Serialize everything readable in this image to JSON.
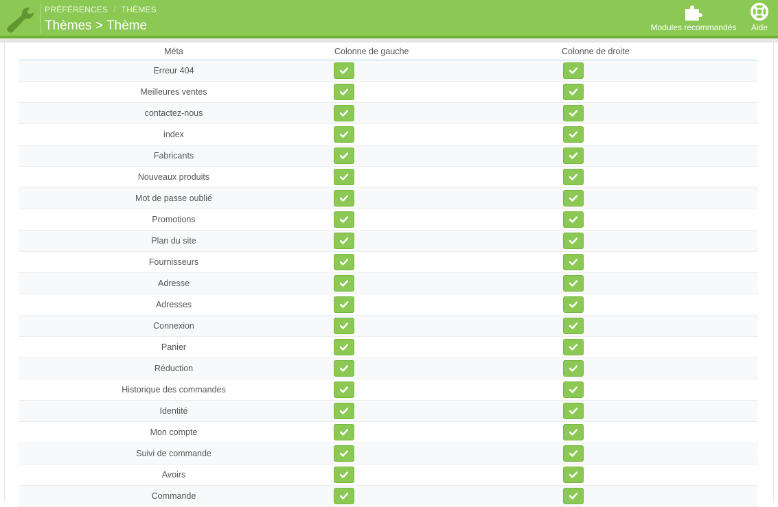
{
  "header": {
    "breadcrumb": [
      "PRÉFÉRENCES",
      "THÈMES"
    ],
    "breadcrumb_separator": "/",
    "title": "Thèmes > Thème",
    "toolbar": [
      {
        "label": "Modules recommandés",
        "icon": "puzzle-icon"
      },
      {
        "label": "Aide",
        "icon": "lifebuoy-icon"
      }
    ],
    "brand_icon": "wrench-icon"
  },
  "table": {
    "columns": [
      "Méta",
      "Colonne de gauche",
      "Colonne de droite"
    ],
    "rows": [
      {
        "meta": "Erreur 404",
        "left": true,
        "right": true
      },
      {
        "meta": "Meilleures ventes",
        "left": true,
        "right": true
      },
      {
        "meta": "contactez-nous",
        "left": true,
        "right": true
      },
      {
        "meta": "index",
        "left": true,
        "right": true
      },
      {
        "meta": "Fabricants",
        "left": true,
        "right": true
      },
      {
        "meta": "Nouveaux produits",
        "left": true,
        "right": true
      },
      {
        "meta": "Mot de passe oublié",
        "left": true,
        "right": true
      },
      {
        "meta": "Promotions",
        "left": true,
        "right": true
      },
      {
        "meta": "Plan du site",
        "left": true,
        "right": true
      },
      {
        "meta": "Fournisseurs",
        "left": true,
        "right": true
      },
      {
        "meta": "Adresse",
        "left": true,
        "right": true
      },
      {
        "meta": "Adresses",
        "left": true,
        "right": true
      },
      {
        "meta": "Connexion",
        "left": true,
        "right": true
      },
      {
        "meta": "Panier",
        "left": true,
        "right": true
      },
      {
        "meta": "Réduction",
        "left": true,
        "right": true
      },
      {
        "meta": "Historique des commandes",
        "left": true,
        "right": true
      },
      {
        "meta": "Identité",
        "left": true,
        "right": true
      },
      {
        "meta": "Mon compte",
        "left": true,
        "right": true
      },
      {
        "meta": "Suivi de commande",
        "left": true,
        "right": true
      },
      {
        "meta": "Avoirs",
        "left": true,
        "right": true
      },
      {
        "meta": "Commande",
        "left": true,
        "right": true
      }
    ]
  },
  "colors": {
    "header_green": "#8bc954",
    "header_dark_line": "#72b034",
    "check_green": "#8bc954",
    "header_rule": "#a8dbe6"
  }
}
